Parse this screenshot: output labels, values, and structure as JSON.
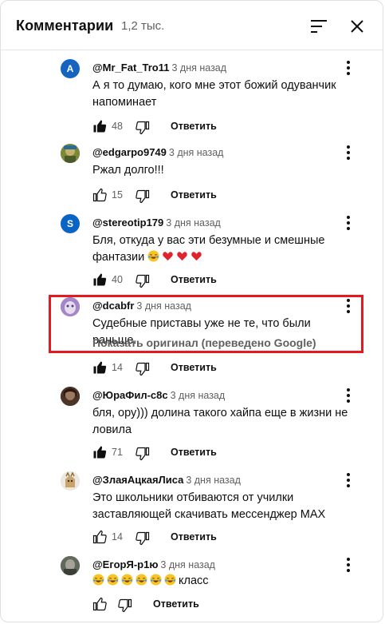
{
  "header": {
    "title": "Комментарии",
    "count": "1,2 тыс."
  },
  "colors": {
    "highlight": "#e5191e",
    "meta_text": "#606060",
    "avatar_A": "#1565c0",
    "avatar_S": "#0b63c4"
  },
  "icons": [
    "sort-icon",
    "close-icon",
    "more-vert-icon",
    "thumb-up-icon",
    "thumb-down-icon",
    "laugh-emoji-icon",
    "heart-emoji-icon"
  ],
  "comments": [
    {
      "author": "@Mr_Fat_Tro11",
      "time": "3 дня назад",
      "avatar_letter": "A",
      "text": "А я то думаю, кого мне этот божий одуванчик напоминает",
      "likes": "48",
      "liked": true,
      "reply": "Ответить"
    },
    {
      "author": "@edgarpo9749",
      "time": "3 дня назад",
      "avatar_letter": "",
      "text": "Ржал долго!!!",
      "likes": "15",
      "liked": false,
      "reply": "Ответить"
    },
    {
      "author": "@stereotip179",
      "time": "3 дня назад",
      "avatar_letter": "S",
      "text": "Бля, откуда у вас эти безумные и смешные фантазии",
      "emojis": [
        "laugh",
        "heart",
        "heart",
        "heart"
      ],
      "likes": "40",
      "liked": true,
      "reply": "Ответить"
    },
    {
      "author": "@dcabfr",
      "time": "3 дня назад",
      "avatar_letter": "",
      "text": "Судебные приставы уже не те, что были раньше.",
      "translate": "Показать оригинал (переведено Google)",
      "likes": "14",
      "liked": true,
      "reply": "Ответить"
    },
    {
      "author": "@ЮраФил-с8с",
      "time": "3 дня назад",
      "avatar_letter": "",
      "text": "бля, ору))) долина такого хайпа еще в жизни не ловила",
      "likes": "71",
      "liked": true,
      "reply": "Ответить"
    },
    {
      "author": "@ЗлаяАцкаяЛиса",
      "time": "3 дня назад",
      "avatar_letter": "",
      "text": "Это школьники отбиваются от училки заставляющей скачивать мессенджер MAX",
      "likes": "14",
      "liked": false,
      "reply": "Ответить"
    },
    {
      "author": "@ЕгорЯ-р1ю",
      "time": "3 дня назад",
      "avatar_letter": "",
      "text_suffix": "класс",
      "emojis": [
        "laugh",
        "laugh",
        "laugh",
        "laugh",
        "laugh",
        "laugh"
      ],
      "likes": "",
      "liked": false,
      "reply": "Ответить"
    }
  ]
}
